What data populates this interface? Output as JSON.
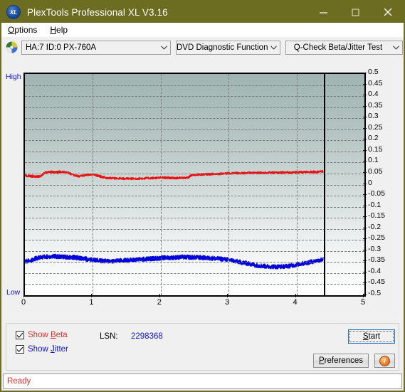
{
  "window": {
    "title": "PlexTools Professional XL V3.16",
    "icon": "xl-disc-icon",
    "icon_text": "XL",
    "titlebar_color": "#6d6d21",
    "minimize_label": "—",
    "maximize_label": "□",
    "close_label": "×"
  },
  "menubar": {
    "items": [
      {
        "label": "Options",
        "accel": "O"
      },
      {
        "label": "Help",
        "accel": "H"
      }
    ]
  },
  "toolbar": {
    "drive_icon": "cd-disc-icon",
    "drive_combo": {
      "value": "HA:7 ID:0  PX-760A",
      "options": [
        "HA:7 ID:0  PX-760A"
      ]
    },
    "function_combo": {
      "value": "DVD Diagnostic Functions",
      "options": [
        "DVD Diagnostic Functions"
      ]
    },
    "test_combo": {
      "value": "Q-Check Beta/Jitter Test",
      "options": [
        "Q-Check Beta/Jitter Test"
      ]
    }
  },
  "chart_axis": {
    "high_label": "High",
    "low_label": "Low",
    "y_ticks": [
      "0.5",
      "0.45",
      "0.4",
      "0.35",
      "0.3",
      "0.25",
      "0.2",
      "0.15",
      "0.1",
      "0.05",
      "0",
      "-0.05",
      "-0.1",
      "-0.15",
      "-0.2",
      "-0.25",
      "-0.3",
      "-0.35",
      "-0.4",
      "-0.45",
      "-0.5"
    ],
    "x_ticks": [
      "0",
      "1",
      "2",
      "3",
      "4",
      "5"
    ]
  },
  "controls": {
    "show_beta": {
      "label_pre": "Show ",
      "label_accel": "B",
      "label_post": "eta",
      "checked": true,
      "color": "#e03030"
    },
    "show_jitter": {
      "label_pre": "Show ",
      "label_accel": "J",
      "label_post": "itter",
      "checked": true,
      "color": "#1414c8"
    },
    "lsn_label": "LSN:",
    "lsn_value": "2298368",
    "start_label_pre": "",
    "start_label_accel": "S",
    "start_label_post": "tart",
    "preferences_label_pre": "",
    "preferences_label_accel": "P",
    "preferences_label_post": "references",
    "info_button": "info-icon",
    "info_glyph": "i"
  },
  "status": {
    "text": "Ready",
    "color": "#e03030"
  },
  "chart_data": {
    "type": "line",
    "title": "Q-Check Beta/Jitter Test",
    "xlabel": "",
    "ylabel": "",
    "xlim": [
      0,
      5
    ],
    "ylim": [
      -0.5,
      0.5
    ],
    "grid": true,
    "x_tick_step": 1,
    "y_tick_step": 0.05,
    "data_end_x": 4.4,
    "marker_x": 4.4,
    "legend_position": "bottom-left",
    "series": [
      {
        "name": "Beta",
        "color": "#ee1111",
        "x": [
          0.0,
          0.1,
          0.2,
          0.25,
          0.3,
          0.35,
          0.4,
          0.45,
          0.5,
          0.55,
          0.6,
          0.65,
          0.7,
          0.75,
          0.8,
          0.85,
          0.9,
          0.95,
          1.0,
          1.05,
          1.1,
          1.15,
          1.2,
          1.25,
          1.3,
          1.4,
          1.5,
          1.6,
          1.7,
          1.8,
          1.9,
          2.0,
          2.1,
          2.2,
          2.3,
          2.4,
          2.45,
          2.5,
          2.55,
          2.6,
          2.7,
          2.8,
          2.9,
          3.0,
          3.1,
          3.2,
          3.3,
          3.4,
          3.5,
          3.6,
          3.7,
          3.8,
          3.9,
          4.0,
          4.1,
          4.2,
          4.3,
          4.4
        ],
        "y": [
          0.04,
          0.038,
          0.036,
          0.042,
          0.056,
          0.058,
          0.057,
          0.056,
          0.058,
          0.057,
          0.056,
          0.052,
          0.046,
          0.04,
          0.038,
          0.04,
          0.044,
          0.046,
          0.045,
          0.042,
          0.038,
          0.034,
          0.031,
          0.03,
          0.029,
          0.028,
          0.027,
          0.027,
          0.028,
          0.029,
          0.03,
          0.031,
          0.031,
          0.03,
          0.03,
          0.031,
          0.042,
          0.044,
          0.045,
          0.046,
          0.047,
          0.048,
          0.05,
          0.051,
          0.052,
          0.052,
          0.053,
          0.053,
          0.054,
          0.054,
          0.054,
          0.055,
          0.055,
          0.056,
          0.056,
          0.057,
          0.058,
          0.06
        ],
        "noise": 0.0055
      },
      {
        "name": "Jitter",
        "color": "#0000dd",
        "x": [
          0.0,
          0.05,
          0.1,
          0.15,
          0.2,
          0.25,
          0.3,
          0.35,
          0.4,
          0.45,
          0.5,
          0.6,
          0.7,
          0.8,
          0.9,
          1.0,
          1.1,
          1.2,
          1.3,
          1.4,
          1.5,
          1.6,
          1.7,
          1.8,
          1.9,
          2.0,
          2.1,
          2.2,
          2.3,
          2.4,
          2.5,
          2.6,
          2.7,
          2.8,
          2.9,
          3.0,
          3.1,
          3.2,
          3.3,
          3.4,
          3.5,
          3.6,
          3.7,
          3.8,
          3.9,
          4.0,
          4.1,
          4.2,
          4.3,
          4.35,
          4.4
        ],
        "y": [
          -0.348,
          -0.346,
          -0.342,
          -0.335,
          -0.33,
          -0.328,
          -0.326,
          -0.325,
          -0.324,
          -0.325,
          -0.326,
          -0.327,
          -0.328,
          -0.332,
          -0.336,
          -0.34,
          -0.344,
          -0.346,
          -0.345,
          -0.344,
          -0.342,
          -0.34,
          -0.338,
          -0.336,
          -0.334,
          -0.332,
          -0.33,
          -0.329,
          -0.328,
          -0.328,
          -0.329,
          -0.33,
          -0.332,
          -0.334,
          -0.336,
          -0.34,
          -0.346,
          -0.352,
          -0.358,
          -0.364,
          -0.368,
          -0.37,
          -0.371,
          -0.37,
          -0.367,
          -0.362,
          -0.356,
          -0.35,
          -0.344,
          -0.34,
          -0.337
        ],
        "noise": 0.011
      }
    ]
  }
}
